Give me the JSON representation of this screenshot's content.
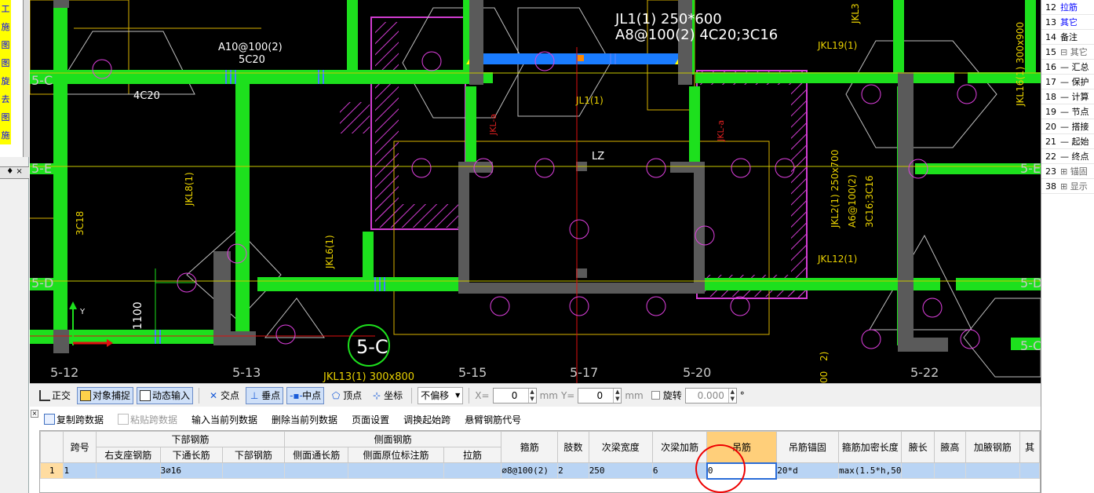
{
  "left_panel": {
    "chars": [
      "工",
      "施",
      "图",
      "图",
      "旋",
      "去",
      "图",
      "施"
    ],
    "pin": "♦ ×"
  },
  "canvas_labels": {
    "jl1_top": "JL1(1) 250*600",
    "jl1_rebar": "A8@100(2) 4C20;3C16",
    "a10": "A10@100(2)",
    "c5c20": "5C20",
    "c4c20": "4C20",
    "jkl19": "JKL19(1)",
    "jkl16": "JKL16(1) 300x900",
    "jl1b": "JL1(1)",
    "lz": "LZ",
    "jkl8": "JKL8(1)",
    "c3c18": "3C18",
    "jkl6": "JKL6(1)",
    "jkla1": "JKL-a",
    "jkla2": "JKL-a",
    "jkl2a": "JKL2(1) 250x700",
    "jkl2b": "A6@100(2)",
    "jkl2c": "3C16;3C16",
    "jkl12": "JKL12(1)",
    "jkl13": "JKL13(1) 300x800",
    "axis5c": "5-C",
    "d1100": "1100",
    "ax512": "5-12",
    "ax513": "5-13",
    "ax515": "5-15",
    "ax517": "5-17",
    "ax520": "5-20",
    "ax522": "5-22",
    "ax5d1": "5-D",
    "ax5d2": "5-D",
    "ax5e1": "5-E",
    "ax5e2": "5-E",
    "ax5c2": "5-C",
    "ax5c3": "5-C",
    "jkl3": "JKL3",
    "y": "Y",
    "v00": "00",
    "v2": "2)"
  },
  "toolbar": {
    "orthogonal": "正交",
    "snap": "对象捕捉",
    "dynamic_input": "动态输入",
    "intersection": "交点",
    "perpendicular": "垂点",
    "midpoint": "中点",
    "vertex": "顶点",
    "coordinate": "坐标",
    "offset": "不偏移",
    "x_label": "X=",
    "x_value": "0",
    "mm1": "mm",
    "y_label": "Y=",
    "y_value": "0",
    "mm2": "mm",
    "rotate": "旋转",
    "rotate_value": "0.000",
    "degree": "°"
  },
  "toolbar2": {
    "copy_span": "复制跨数据",
    "paste_span": "粘贴跨数据",
    "input_col": "输入当前列数据",
    "delete_col": "删除当前列数据",
    "page_setup": "页面设置",
    "adjust_start": "调换起始跨",
    "cantilever": "悬臂钢筋代号"
  },
  "table": {
    "h_span": "跨号",
    "h_bottom": "下部钢筋",
    "h_side": "侧面钢筋",
    "h_stirrup": "箍筋",
    "h_legs": "肢数",
    "h_sec_width": "次梁宽度",
    "h_sec_add": "次梁加筋",
    "h_hanger": "吊筋",
    "h_hanger_anchor": "吊筋锚固",
    "h_dense_len": "箍筋加密长度",
    "h_haunch_len": "腋长",
    "h_haunch_h": "腋高",
    "h_haunch_bar": "加腋钢筋",
    "h_other": "其",
    "s_right_support": "右支座钢筋",
    "s_bottom_through": "下通长筋",
    "s_bottom_bar": "下部钢筋",
    "s_side_through": "侧面通长筋",
    "s_side_orig": "侧面原位标注筋",
    "s_tie": "拉筋",
    "row": {
      "idx": "1",
      "span": "1",
      "right_support": "",
      "bottom_through": "3⌀16",
      "bottom_bar": "",
      "side_through": "",
      "side_orig": "",
      "tie": "",
      "stirrup": "⌀8@100(2)",
      "legs": "2",
      "sec_width": "250",
      "sec_add": "6",
      "hanger": "0",
      "hanger_anchor": "20*d",
      "dense_len": "max(1.5*h,50",
      "haunch_len": "",
      "haunch_h": "",
      "haunch_bar": "",
      "other": ""
    }
  },
  "right_panel": {
    "rows": [
      {
        "n": "12",
        "t": "拉筋",
        "blue": true
      },
      {
        "n": "13",
        "t": "其它",
        "blue": true
      },
      {
        "n": "14",
        "t": "备注"
      },
      {
        "n": "15",
        "t": "⊟ 其它"
      },
      {
        "n": "16",
        "t": "— 汇总"
      },
      {
        "n": "17",
        "t": "— 保护"
      },
      {
        "n": "18",
        "t": "— 计算"
      },
      {
        "n": "19",
        "t": "— 节点"
      },
      {
        "n": "20",
        "t": "— 搭接"
      },
      {
        "n": "21",
        "t": "— 起始"
      },
      {
        "n": "22",
        "t": "— 终点"
      },
      {
        "n": "23",
        "t": "⊞ 锚固"
      },
      {
        "n": "38",
        "t": "⊞ 显示"
      }
    ]
  }
}
